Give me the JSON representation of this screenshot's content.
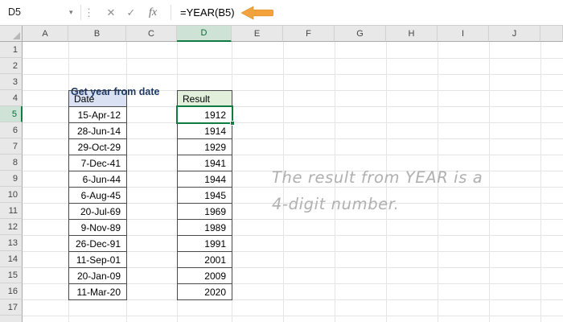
{
  "formula_bar": {
    "name_box": "D5",
    "cancel_icon": "✕",
    "enter_icon": "✓",
    "fx_label": "fx",
    "formula": "=YEAR(B5)"
  },
  "grid": {
    "columns": [
      "A",
      "B",
      "C",
      "D",
      "E",
      "F",
      "G",
      "H",
      "I",
      "J"
    ],
    "rows": [
      "1",
      "2",
      "3",
      "4",
      "5",
      "6",
      "7",
      "8",
      "9",
      "10",
      "11",
      "12",
      "13",
      "14",
      "15",
      "16",
      "17"
    ],
    "selected_cell": "D5",
    "selected_column": "D",
    "selected_row": "5"
  },
  "sheet": {
    "title": "Get year from date",
    "table": {
      "date_header": "Date",
      "result_header": "Result",
      "dates": [
        "15-Apr-12",
        "28-Jun-14",
        "29-Oct-29",
        "7-Dec-41",
        "6-Jun-44",
        "6-Aug-45",
        "20-Jul-69",
        "9-Nov-89",
        "26-Dec-91",
        "11-Sep-01",
        "20-Jan-09",
        "11-Mar-20"
      ],
      "results": [
        "1912",
        "1914",
        "1929",
        "1941",
        "1944",
        "1945",
        "1969",
        "1989",
        "1991",
        "2001",
        "2009",
        "2020"
      ]
    },
    "annotation": {
      "line1": "The result from YEAR is a",
      "line2": "4-digit number."
    }
  },
  "colors": {
    "selection_green": "#107C41",
    "selected_header_fill": "#CEE3D6",
    "selected_header_text": "#0C6B37",
    "header_fill": "#E8E8E8",
    "header_text": "#444444",
    "cell_border": "#4a4a4a",
    "gridline": "#E4E4E4",
    "date_header_fill": "#D9E1F2",
    "result_header_fill": "#E2EFDA",
    "arrow_orange": "#F2A33C",
    "title_navy": "#1F3864",
    "annotation_gray": "#B0B0B0"
  }
}
